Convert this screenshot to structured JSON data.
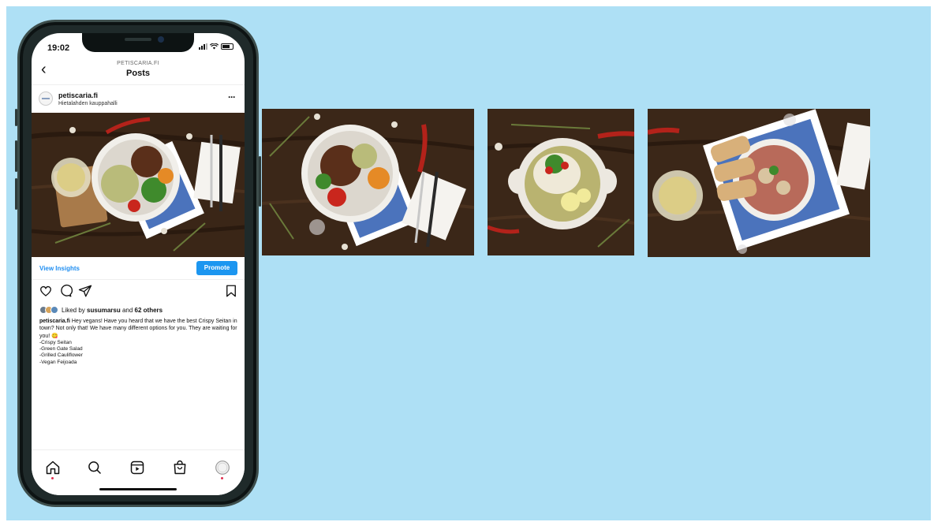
{
  "status_bar": {
    "time": "19:02"
  },
  "nav": {
    "subtitle": "PETISCARIA.FI",
    "title": "Posts",
    "back_icon": "chevron-left-icon"
  },
  "post": {
    "username": "petiscaria.fi",
    "location": "Hietalahden kauppahalli",
    "more_icon": "ellipsis-icon",
    "insights_label": "View Insights",
    "promote_label": "Promote",
    "likes": {
      "prefix": "Liked by ",
      "user": "susumarsu",
      "middle": " and ",
      "count": "62 others"
    },
    "caption": {
      "user": "petiscaria.fi",
      "text": "Hey vegans! Have you heard that we have the best Crispy Seitan in town? Not only that! We have many different options for you. They are waiting for you! 😋",
      "items": [
        "-Crispy Seitan",
        "-Green Gate Salad",
        "-Grilled Cauliflower",
        "-Vegan Feijoada"
      ]
    }
  },
  "tabs": [
    {
      "name": "home-icon"
    },
    {
      "name": "search-icon"
    },
    {
      "name": "reels-icon"
    },
    {
      "name": "shop-icon"
    },
    {
      "name": "profile-icon"
    }
  ],
  "colors": {
    "background": "#aee0f5",
    "accent": "#1c96f0",
    "wood": "#3b2718"
  }
}
